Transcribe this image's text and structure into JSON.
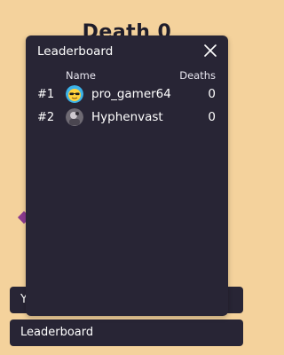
{
  "background": {
    "title": "Death 0",
    "bg_color": "#f4d29c"
  },
  "modal": {
    "title": "Leaderboard",
    "close_icon": "close-icon",
    "columns": {
      "name": "Name",
      "deaths": "Deaths"
    },
    "rows": [
      {
        "rank": "#1",
        "name": "pro_gamer64",
        "deaths": "0",
        "avatar": "emoji-sunglasses-avatar"
      },
      {
        "rank": "#2",
        "name": "Hyphenvast",
        "deaths": "0",
        "avatar": "photo-avatar"
      }
    ]
  },
  "bottom": {
    "bar1_label": "Y",
    "bar2_label": "Leaderboard"
  },
  "colors": {
    "panel": "#282535",
    "text": "#ffffff"
  }
}
